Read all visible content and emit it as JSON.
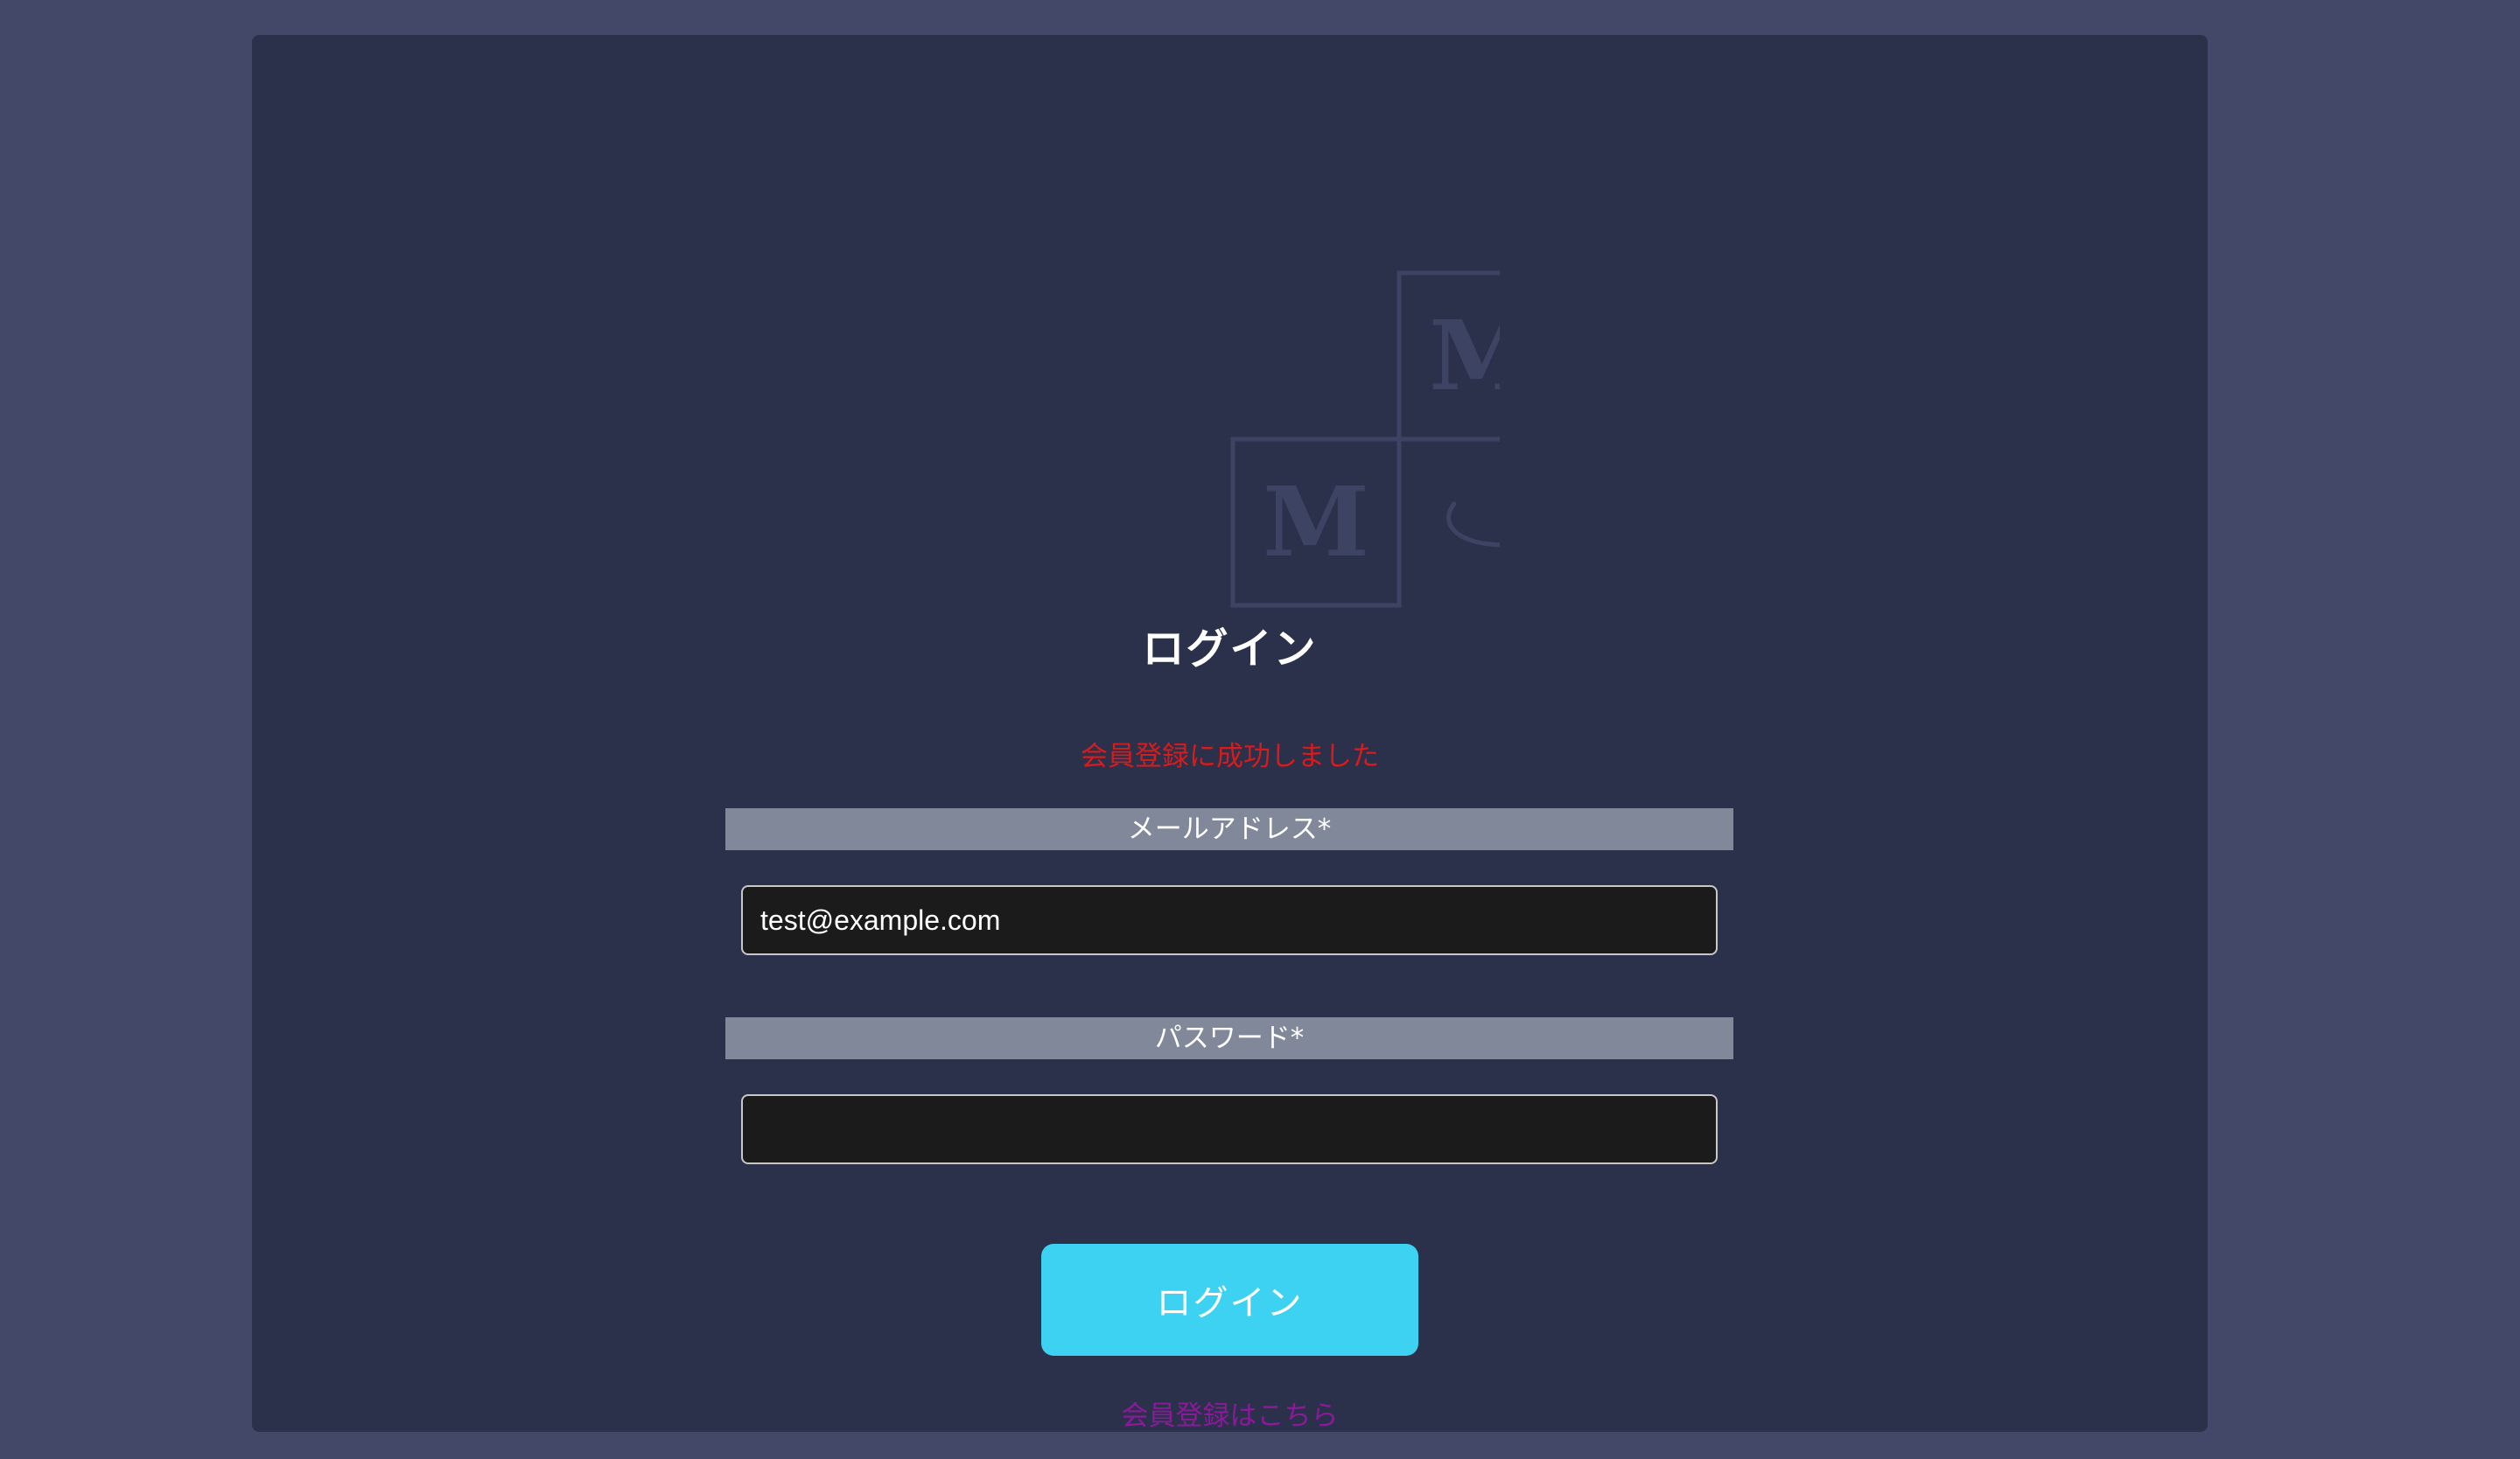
{
  "logo": {
    "letters": [
      "M",
      "M",
      "G"
    ],
    "accent_color": "#3dd2f2"
  },
  "page_title": "ログイン",
  "success_message": "会員登録に成功しました",
  "form": {
    "email_label": "メールアドレス*",
    "email_value": "test@example.com",
    "password_label": "パスワード*",
    "password_value": ""
  },
  "login_button_label": "ログイン",
  "register_link_label": "会員登録はこちら",
  "colors": {
    "background": "#434868",
    "card": "#2b304b",
    "accent": "#3dd2f2",
    "error_text": "#d81b1b",
    "link_text": "#8a1a9a",
    "label_bar": "#818899"
  }
}
